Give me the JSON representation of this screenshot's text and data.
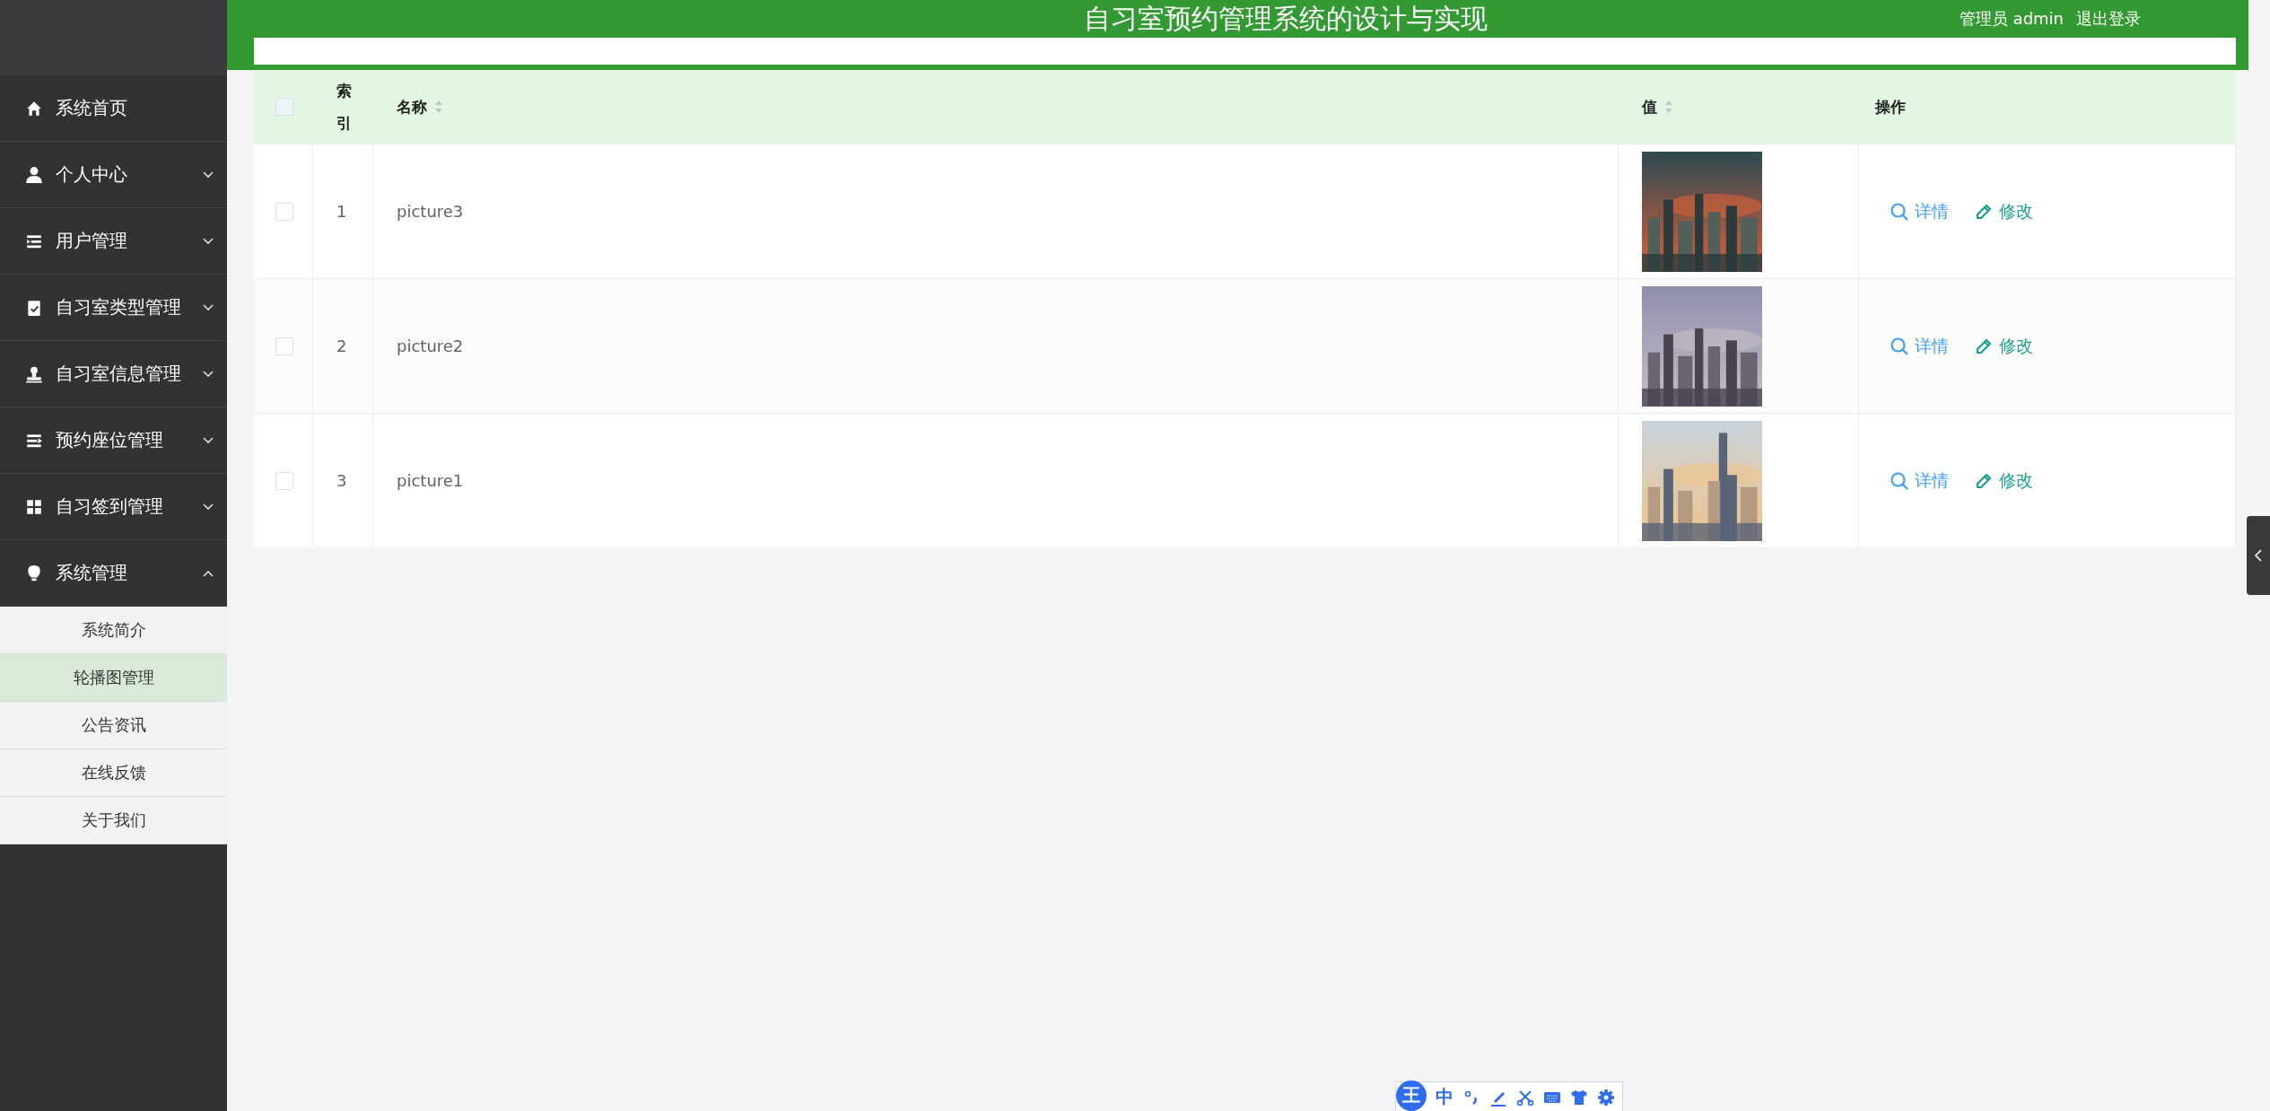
{
  "header": {
    "title": "自习室预约管理系统的设计与实现",
    "user": "管理员 admin",
    "logout": "退出登录"
  },
  "sidebar": {
    "items": [
      {
        "label": "系统首页"
      },
      {
        "label": "个人中心",
        "expanded": false
      },
      {
        "label": "用户管理",
        "expanded": false
      },
      {
        "label": "自习室类型管理",
        "expanded": false
      },
      {
        "label": "自习室信息管理",
        "expanded": false
      },
      {
        "label": "预约座位管理",
        "expanded": false
      },
      {
        "label": "自习签到管理",
        "expanded": false
      },
      {
        "label": "系统管理",
        "expanded": true,
        "children": [
          {
            "label": "系统简介",
            "selected": false
          },
          {
            "label": "轮播图管理",
            "selected": true
          },
          {
            "label": "公告资讯",
            "selected": false
          },
          {
            "label": "在线反馈",
            "selected": false
          },
          {
            "label": "关于我们",
            "selected": false
          }
        ]
      }
    ]
  },
  "table": {
    "select_all_checked": false,
    "columns": [
      {
        "label": "索引",
        "sortable": false
      },
      {
        "label": "名称",
        "sortable": true
      },
      {
        "label": "值",
        "sortable": true
      },
      {
        "label": "操作",
        "sortable": false
      }
    ],
    "rows": [
      {
        "checked": false,
        "index": "1",
        "name": "picture3",
        "value": {
          "kind": "picture"
        },
        "actions": [
          "详情",
          "修改"
        ]
      },
      {
        "checked": false,
        "index": "2",
        "name": "picture2",
        "value": {
          "kind": "picture"
        },
        "actions": [
          "详情",
          "修改"
        ]
      },
      {
        "checked": false,
        "index": "3",
        "name": "picture1",
        "value": {
          "kind": "picture"
        },
        "actions": [
          "详情",
          "修改"
        ]
      }
    ]
  },
  "ime_toolbar": {
    "logo": "王",
    "mode": "中"
  }
}
